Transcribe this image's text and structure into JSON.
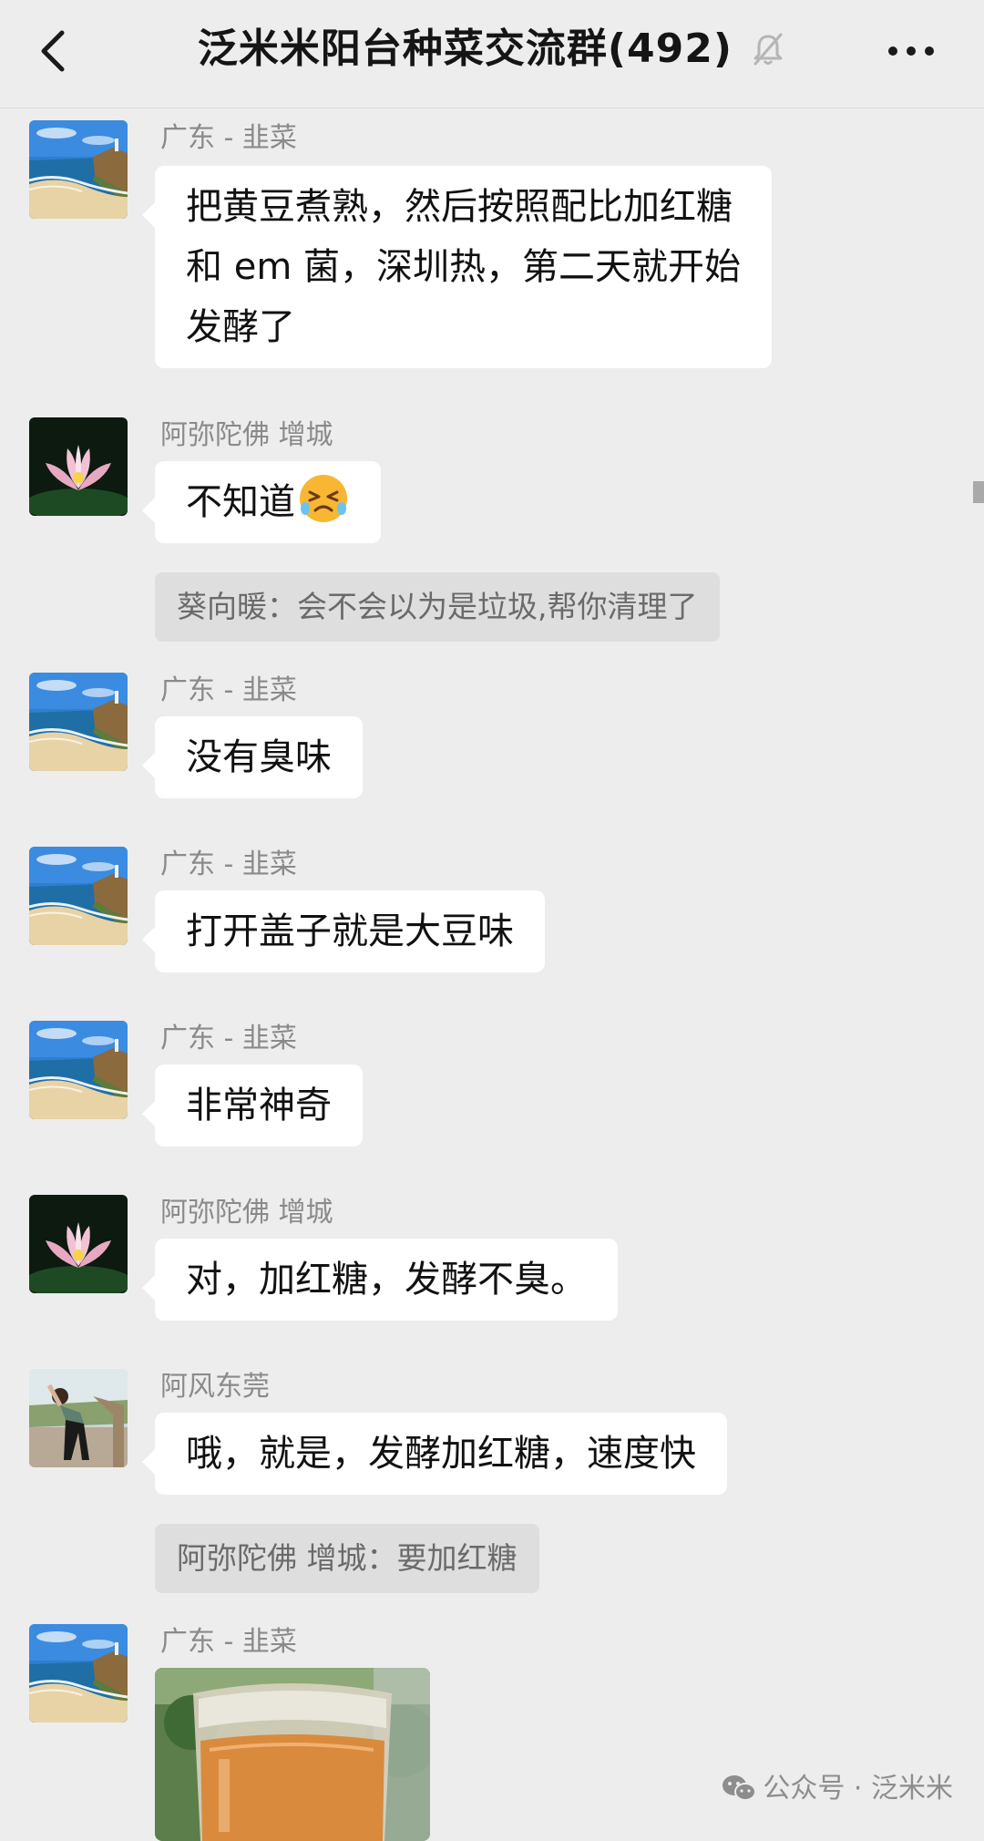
{
  "header": {
    "title": "泛米米阳台种菜交流群(492)",
    "back_icon": "chevron-left-icon",
    "mute_icon": "bell-muted-icon",
    "more_icon": "more-dots-icon"
  },
  "messages": [
    {
      "sender": "广东 - 韭菜",
      "avatar": "avatar-seaside",
      "lines": [
        "把黄豆煮熟，然后按照配比加红糖",
        "和 em 菌，深圳热，第二天就开始",
        "发酵了"
      ]
    },
    {
      "sender": "阿弥陀佛 增城",
      "avatar": "avatar-lotus",
      "text": "不知道",
      "emoji": "crying-laughing-emoji",
      "quote": "葵向暖：会不会以为是垃圾,帮你清理了"
    },
    {
      "sender": "广东 - 韭菜",
      "avatar": "avatar-seaside",
      "text": "没有臭味"
    },
    {
      "sender": "广东 - 韭菜",
      "avatar": "avatar-seaside",
      "text": "打开盖子就是大豆味"
    },
    {
      "sender": "广东 - 韭菜",
      "avatar": "avatar-seaside",
      "text": "非常神奇"
    },
    {
      "sender": "阿弥陀佛 增城",
      "avatar": "avatar-lotus",
      "text": "对，加红糖，发酵不臭。"
    },
    {
      "sender": "阿风东莞",
      "avatar": "avatar-exercise-woman",
      "text": "哦，就是，发酵加红糖，速度快",
      "quote": "阿弥陀佛 增城：要加红糖"
    },
    {
      "sender": "广东 - 韭菜",
      "avatar": "avatar-seaside",
      "image": "jar-photo"
    }
  ],
  "watermark": {
    "icon": "wechat-icon",
    "text": "公众号 · 泛米米"
  },
  "colors": {
    "background": "#ededed",
    "bubble": "#ffffff",
    "quote_bg": "#dedede",
    "sender_text": "#8a8a8a"
  }
}
